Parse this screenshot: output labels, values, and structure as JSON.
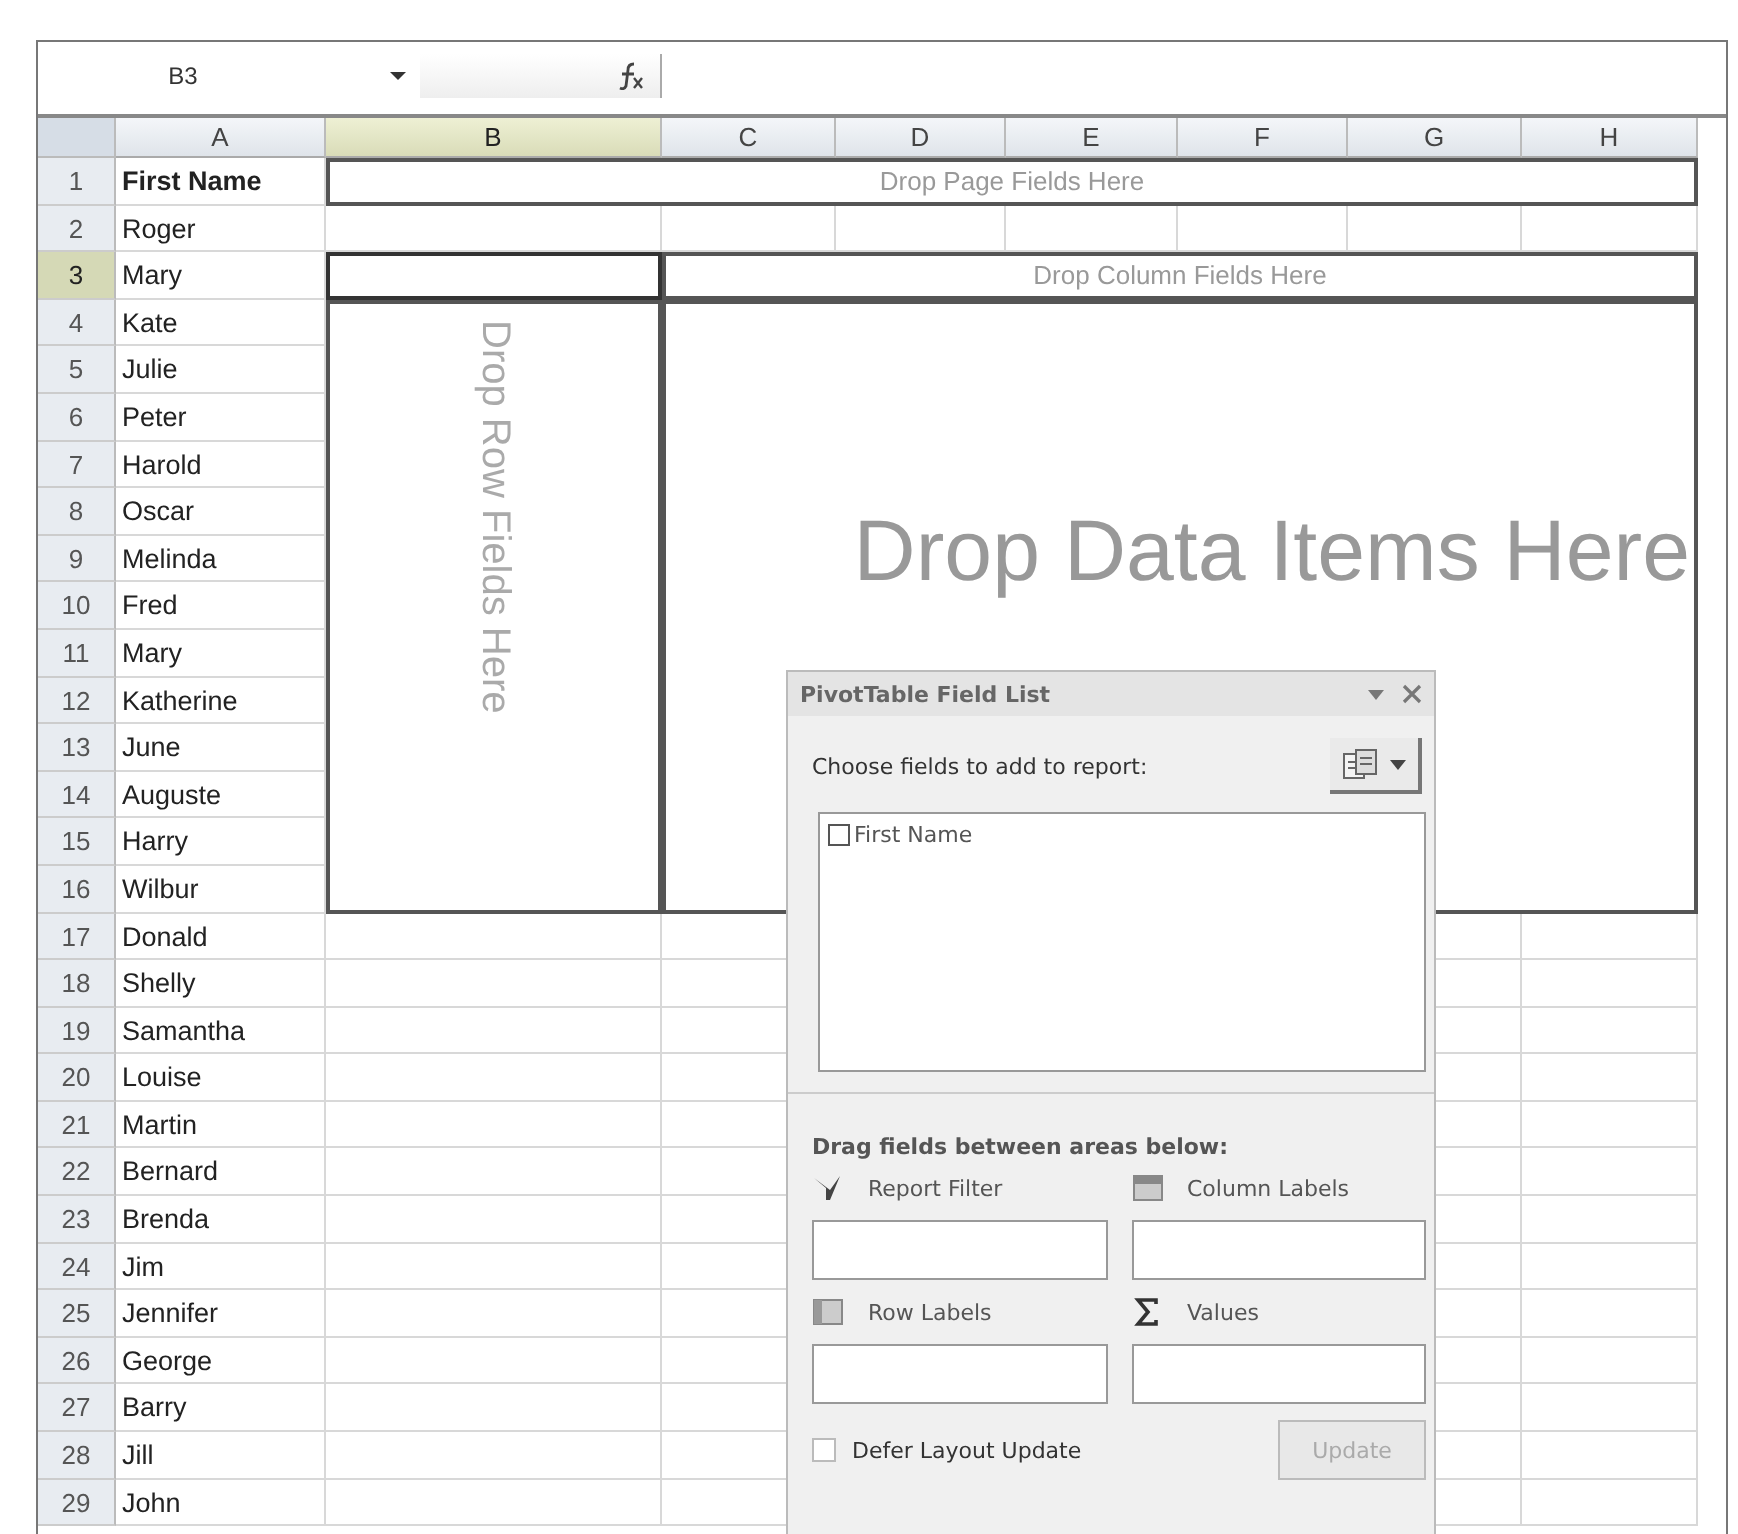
{
  "name_box": "B3",
  "columns": [
    {
      "label": "A",
      "selected": false
    },
    {
      "label": "B",
      "selected": true
    },
    {
      "label": "C",
      "selected": false
    },
    {
      "label": "D",
      "selected": false
    },
    {
      "label": "E",
      "selected": false
    },
    {
      "label": "F",
      "selected": false
    },
    {
      "label": "G",
      "selected": false
    },
    {
      "label": "H",
      "selected": false
    }
  ],
  "rows": [
    {
      "number": "1",
      "value": "First Name",
      "selected": false
    },
    {
      "number": "2",
      "value": "Roger",
      "selected": false
    },
    {
      "number": "3",
      "value": "Mary",
      "selected": true
    },
    {
      "number": "4",
      "value": "Kate",
      "selected": false
    },
    {
      "number": "5",
      "value": "Julie",
      "selected": false
    },
    {
      "number": "6",
      "value": "Peter",
      "selected": false
    },
    {
      "number": "7",
      "value": "Harold",
      "selected": false
    },
    {
      "number": "8",
      "value": "Oscar",
      "selected": false
    },
    {
      "number": "9",
      "value": "Melinda",
      "selected": false
    },
    {
      "number": "10",
      "value": "Fred",
      "selected": false
    },
    {
      "number": "11",
      "value": "Mary",
      "selected": false
    },
    {
      "number": "12",
      "value": "Katherine",
      "selected": false
    },
    {
      "number": "13",
      "value": "June",
      "selected": false
    },
    {
      "number": "14",
      "value": "Auguste",
      "selected": false
    },
    {
      "number": "15",
      "value": "Harry",
      "selected": false
    },
    {
      "number": "16",
      "value": "Wilbur",
      "selected": false
    },
    {
      "number": "17",
      "value": "Donald",
      "selected": false
    },
    {
      "number": "18",
      "value": "Shelly",
      "selected": false
    },
    {
      "number": "19",
      "value": "Samantha",
      "selected": false
    },
    {
      "number": "20",
      "value": "Louise",
      "selected": false
    },
    {
      "number": "21",
      "value": "Martin",
      "selected": false
    },
    {
      "number": "22",
      "value": "Bernard",
      "selected": false
    },
    {
      "number": "23",
      "value": "Brenda",
      "selected": false
    },
    {
      "number": "24",
      "value": "Jim",
      "selected": false
    },
    {
      "number": "25",
      "value": "Jennifer",
      "selected": false
    },
    {
      "number": "26",
      "value": "George",
      "selected": false
    },
    {
      "number": "27",
      "value": "Barry",
      "selected": false
    },
    {
      "number": "28",
      "value": "Jill",
      "selected": false
    },
    {
      "number": "29",
      "value": "John",
      "selected": false
    }
  ],
  "pivot_zones": {
    "page": "Drop Page Fields Here",
    "column": "Drop Column Fields Here",
    "row": "Drop Row Fields Here",
    "data": "Drop Data Items Here"
  },
  "field_list": {
    "title": "PivotTable Field List",
    "choose_label": "Choose fields to add to report:",
    "fields": [
      {
        "name": "First Name",
        "checked": false
      }
    ],
    "drag_label": "Drag fields between areas below:",
    "areas": [
      {
        "kind": "filter",
        "label": "Report Filter"
      },
      {
        "kind": "columns",
        "label": "Column Labels"
      },
      {
        "kind": "rows",
        "label": "Row Labels"
      },
      {
        "kind": "values",
        "label": "Values"
      }
    ],
    "defer": {
      "label": "Defer Layout Update",
      "checked": false
    },
    "update_button": {
      "label": "Update",
      "disabled": true
    }
  }
}
